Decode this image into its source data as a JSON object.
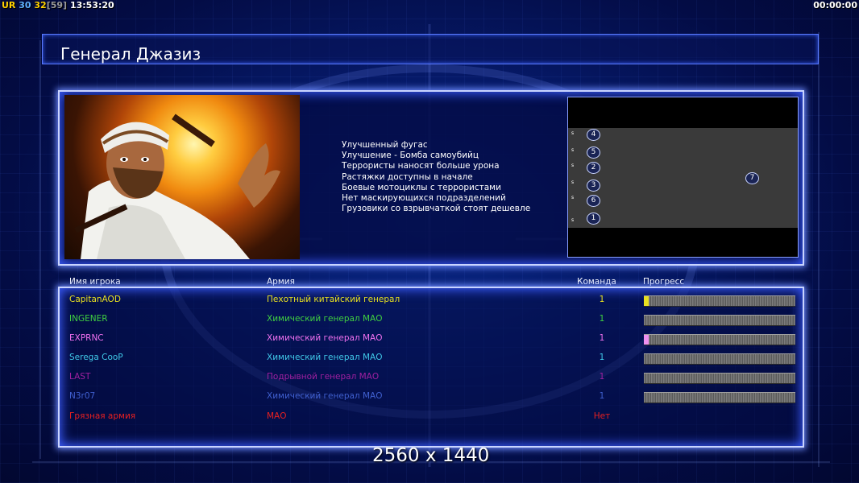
{
  "hud": {
    "ur_label": "UR",
    "fps": "30",
    "fps2": "32",
    "fps_bracket": "[59]",
    "clock": "13:53:20",
    "timer": "00:00:00"
  },
  "screen_title": "Генерал Джазиз",
  "briefing": [
    "Улучшенный фугас",
    "Улучшение - Бомба самоубийц",
    "Террористы наносят больше урона",
    "Растяжки доступны в начале",
    "Боевые мотоциклы с террористами",
    "Нет маскирующихся подразделений",
    "Грузовики со взрывчаткой стоят дешевле"
  ],
  "map": {
    "slots": [
      "4",
      "5",
      "2",
      "3",
      "6",
      "1",
      "7"
    ],
    "slot_marker": "s"
  },
  "table": {
    "headers": {
      "name": "Имя игрока",
      "army": "Армия",
      "team": "Команда",
      "progress": "Прогресс"
    },
    "rows": [
      {
        "name": "CapitanAOD",
        "army": "Пехотный китайский генерал",
        "team": "1",
        "color": "#e8e020",
        "progress": 0.03,
        "fill": "#e8e020"
      },
      {
        "name": "INGENER",
        "army": "Химический генерал МАО",
        "team": "1",
        "color": "#40d040",
        "progress": 0.0,
        "fill": ""
      },
      {
        "name": "EXPRNC",
        "army": "Химический генерал МАО",
        "team": "1",
        "color": "#f070f0",
        "progress": 0.03,
        "fill": "#f090f0"
      },
      {
        "name": "Serega CooP",
        "army": "Химический генерал МАО",
        "team": "1",
        "color": "#40c8e8",
        "progress": 0.0,
        "fill": ""
      },
      {
        "name": "LAST",
        "army": "Подрывной генерал МАО",
        "team": "1",
        "color": "#a020a0",
        "progress": 0.0,
        "fill": ""
      },
      {
        "name": "N3r07",
        "army": "Химический генерал МАО",
        "team": "1",
        "color": "#4060d0",
        "progress": 0.0,
        "fill": ""
      },
      {
        "name": "Грязная армия",
        "army": "МАО",
        "team": "Нет",
        "color": "#e82020",
        "progress": null,
        "fill": ""
      }
    ]
  },
  "watermark": "2560 x 1440"
}
